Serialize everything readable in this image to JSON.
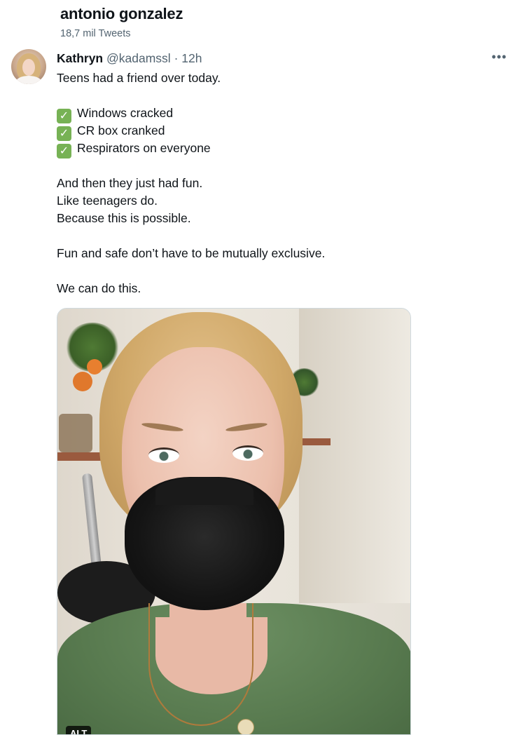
{
  "profile_header": {
    "name": "antonio gonzalez",
    "tweet_count": "18,7 mil Tweets"
  },
  "tweet": {
    "author_name": "Kathryn",
    "author_handle": "@kadamssl",
    "separator": "·",
    "time": "12h",
    "more_icon": "more-horizontal-icon",
    "more_glyph": "•••",
    "lines": [
      "Teens had a friend over today.",
      "Windows cracked",
      "CR box cranked",
      "Respirators on everyone",
      "And then they just had fun.",
      "Like teenagers do.",
      "Because this is possible.",
      "Fun and safe don’t have to be mutually exclusive.",
      "We can do this."
    ],
    "check_glyph": "✓",
    "check_color": "#77b255",
    "media": {
      "alt_label": "ALT"
    }
  },
  "colors": {
    "text_primary": "#0f1419",
    "text_secondary": "#536471",
    "border": "#cfd9de"
  }
}
